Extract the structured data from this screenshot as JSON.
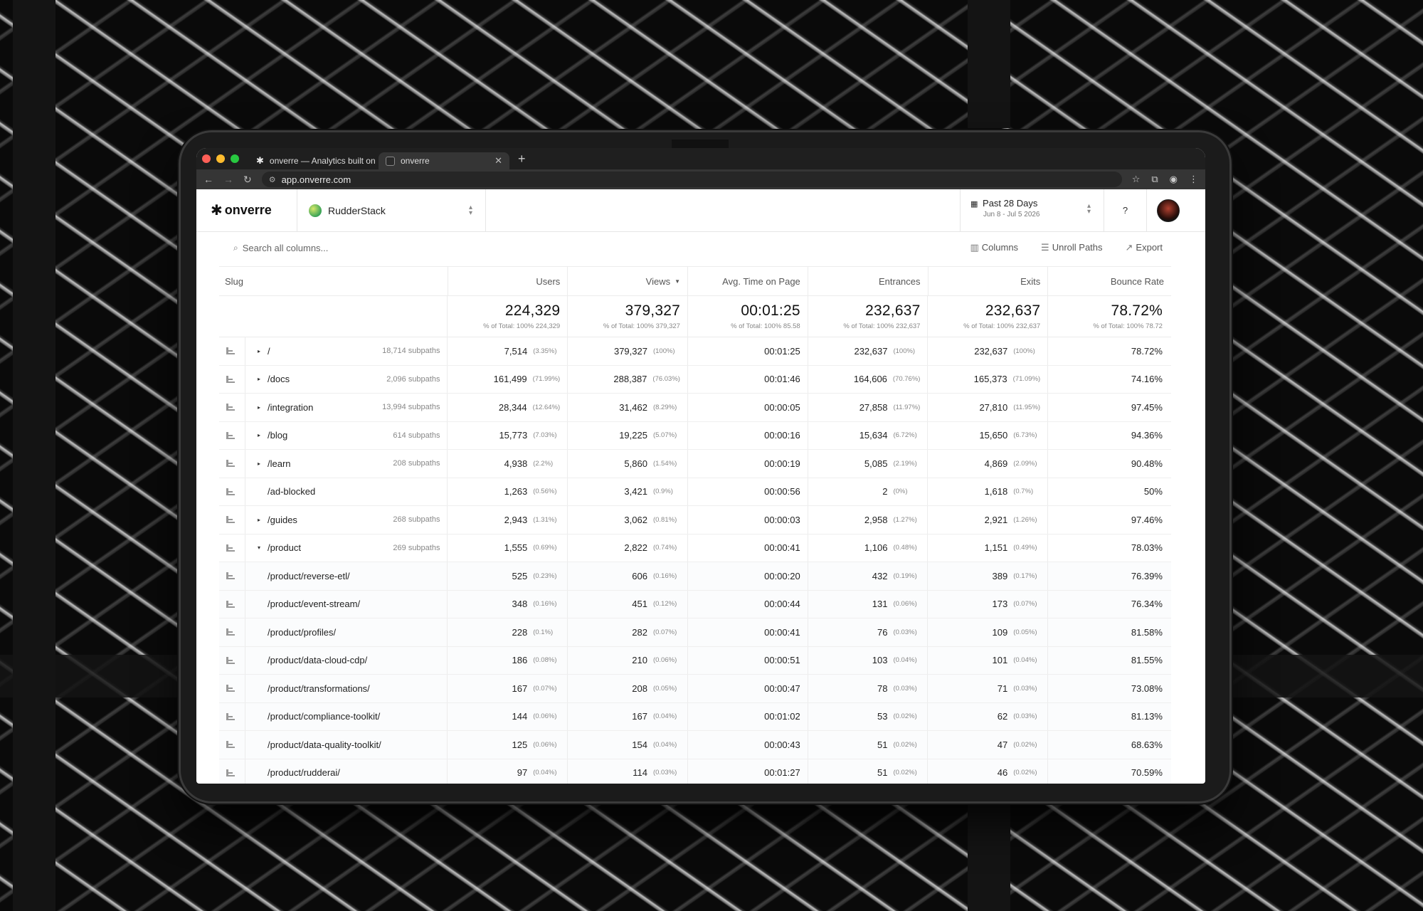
{
  "browser": {
    "tabs": [
      {
        "favicon": "asterisk-icon",
        "label": "onverre — Analytics built on"
      },
      {
        "favicon": "square-icon",
        "label": "onverre"
      }
    ],
    "url": "app.onverre.com",
    "lights": [
      "#ff5f57",
      "#febc2e",
      "#28c840"
    ]
  },
  "app": {
    "logo": "onverre",
    "workspace": "RudderStack",
    "date_label": "Past 28 Days",
    "date_sub": "Jun 8 - Jul 5 2026",
    "help": "?"
  },
  "toolbar": {
    "search_placeholder": "Search all columns...",
    "columns": "Columns",
    "unroll": "Unroll Paths",
    "export": "Export"
  },
  "table": {
    "headers": {
      "slug": "Slug",
      "users": "Users",
      "views": "Views",
      "avg_time": "Avg. Time on Page",
      "entrances": "Entrances",
      "exits": "Exits",
      "bounce": "Bounce Rate"
    },
    "totals": {
      "users": "224,329",
      "users_pct": "% of Total: 100% 224,329",
      "views": "379,327",
      "views_pct": "% of Total: 100% 379,327",
      "avg_time": "00:01:25",
      "avg_time_pct": "% of Total: 100% 85.58",
      "entrances": "232,637",
      "entrances_pct": "% of Total: 100% 232,637",
      "exits": "232,637",
      "exits_pct": "% of Total: 100% 232,637",
      "bounce": "78.72%",
      "bounce_pct": "% of Total: 100% 78.72"
    },
    "rows": [
      {
        "caret": "▸",
        "slug": "/",
        "subpaths": "18,714 subpaths",
        "users": "7,514",
        "users_pct": "(3.35%)",
        "views": "379,327",
        "views_pct": "(100%)",
        "time": "00:01:25",
        "ent": "232,637",
        "ent_pct": "(100%)",
        "exits": "232,637",
        "exits_pct": "(100%)",
        "bounce": "78.72%"
      },
      {
        "caret": "▸",
        "slug": "/docs",
        "subpaths": "2,096 subpaths",
        "users": "161,499",
        "users_pct": "(71.99%)",
        "views": "288,387",
        "views_pct": "(76.03%)",
        "time": "00:01:46",
        "ent": "164,606",
        "ent_pct": "(70.76%)",
        "exits": "165,373",
        "exits_pct": "(71.09%)",
        "bounce": "74.16%"
      },
      {
        "caret": "▸",
        "slug": "/integration",
        "subpaths": "13,994 subpaths",
        "users": "28,344",
        "users_pct": "(12.64%)",
        "views": "31,462",
        "views_pct": "(8.29%)",
        "time": "00:00:05",
        "ent": "27,858",
        "ent_pct": "(11.97%)",
        "exits": "27,810",
        "exits_pct": "(11.95%)",
        "bounce": "97.45%"
      },
      {
        "caret": "▸",
        "slug": "/blog",
        "subpaths": "614 subpaths",
        "users": "15,773",
        "users_pct": "(7.03%)",
        "views": "19,225",
        "views_pct": "(5.07%)",
        "time": "00:00:16",
        "ent": "15,634",
        "ent_pct": "(6.72%)",
        "exits": "15,650",
        "exits_pct": "(6.73%)",
        "bounce": "94.36%"
      },
      {
        "caret": "▸",
        "slug": "/learn",
        "subpaths": "208 subpaths",
        "users": "4,938",
        "users_pct": "(2.2%)",
        "views": "5,860",
        "views_pct": "(1.54%)",
        "time": "00:00:19",
        "ent": "5,085",
        "ent_pct": "(2.19%)",
        "exits": "4,869",
        "exits_pct": "(2.09%)",
        "bounce": "90.48%"
      },
      {
        "caret": "",
        "slug": "/ad-blocked",
        "subpaths": "",
        "users": "1,263",
        "users_pct": "(0.56%)",
        "views": "3,421",
        "views_pct": "(0.9%)",
        "time": "00:00:56",
        "ent": "2",
        "ent_pct": "(0%)",
        "exits": "1,618",
        "exits_pct": "(0.7%)",
        "bounce": "50%"
      },
      {
        "caret": "▸",
        "slug": "/guides",
        "subpaths": "268 subpaths",
        "users": "2,943",
        "users_pct": "(1.31%)",
        "views": "3,062",
        "views_pct": "(0.81%)",
        "time": "00:00:03",
        "ent": "2,958",
        "ent_pct": "(1.27%)",
        "exits": "2,921",
        "exits_pct": "(1.26%)",
        "bounce": "97.46%"
      },
      {
        "caret": "▾",
        "slug": "/product",
        "subpaths": "269 subpaths",
        "users": "1,555",
        "users_pct": "(0.69%)",
        "views": "2,822",
        "views_pct": "(0.74%)",
        "time": "00:00:41",
        "ent": "1,106",
        "ent_pct": "(0.48%)",
        "exits": "1,151",
        "exits_pct": "(0.49%)",
        "bounce": "78.03%"
      },
      {
        "caret": "",
        "slug": "/product/reverse-etl/",
        "subpaths": "",
        "users": "525",
        "users_pct": "(0.23%)",
        "views": "606",
        "views_pct": "(0.16%)",
        "time": "00:00:20",
        "ent": "432",
        "ent_pct": "(0.19%)",
        "exits": "389",
        "exits_pct": "(0.17%)",
        "bounce": "76.39%"
      },
      {
        "caret": "",
        "slug": "/product/event-stream/",
        "subpaths": "",
        "users": "348",
        "users_pct": "(0.16%)",
        "views": "451",
        "views_pct": "(0.12%)",
        "time": "00:00:44",
        "ent": "131",
        "ent_pct": "(0.06%)",
        "exits": "173",
        "exits_pct": "(0.07%)",
        "bounce": "76.34%"
      },
      {
        "caret": "",
        "slug": "/product/profiles/",
        "subpaths": "",
        "users": "228",
        "users_pct": "(0.1%)",
        "views": "282",
        "views_pct": "(0.07%)",
        "time": "00:00:41",
        "ent": "76",
        "ent_pct": "(0.03%)",
        "exits": "109",
        "exits_pct": "(0.05%)",
        "bounce": "81.58%"
      },
      {
        "caret": "",
        "slug": "/product/data-cloud-cdp/",
        "subpaths": "",
        "users": "186",
        "users_pct": "(0.08%)",
        "views": "210",
        "views_pct": "(0.06%)",
        "time": "00:00:51",
        "ent": "103",
        "ent_pct": "(0.04%)",
        "exits": "101",
        "exits_pct": "(0.04%)",
        "bounce": "81.55%"
      },
      {
        "caret": "",
        "slug": "/product/transformations/",
        "subpaths": "",
        "users": "167",
        "users_pct": "(0.07%)",
        "views": "208",
        "views_pct": "(0.05%)",
        "time": "00:00:47",
        "ent": "78",
        "ent_pct": "(0.03%)",
        "exits": "71",
        "exits_pct": "(0.03%)",
        "bounce": "73.08%"
      },
      {
        "caret": "",
        "slug": "/product/compliance-toolkit/",
        "subpaths": "",
        "users": "144",
        "users_pct": "(0.06%)",
        "views": "167",
        "views_pct": "(0.04%)",
        "time": "00:01:02",
        "ent": "53",
        "ent_pct": "(0.02%)",
        "exits": "62",
        "exits_pct": "(0.03%)",
        "bounce": "81.13%"
      },
      {
        "caret": "",
        "slug": "/product/data-quality-toolkit/",
        "subpaths": "",
        "users": "125",
        "users_pct": "(0.06%)",
        "views": "154",
        "views_pct": "(0.04%)",
        "time": "00:00:43",
        "ent": "51",
        "ent_pct": "(0.02%)",
        "exits": "47",
        "exits_pct": "(0.02%)",
        "bounce": "68.63%"
      },
      {
        "caret": "",
        "slug": "/product/rudderai/",
        "subpaths": "",
        "users": "97",
        "users_pct": "(0.04%)",
        "views": "114",
        "views_pct": "(0.03%)",
        "time": "00:01:27",
        "ent": "51",
        "ent_pct": "(0.02%)",
        "exits": "46",
        "exits_pct": "(0.02%)",
        "bounce": "70.59%"
      }
    ]
  }
}
